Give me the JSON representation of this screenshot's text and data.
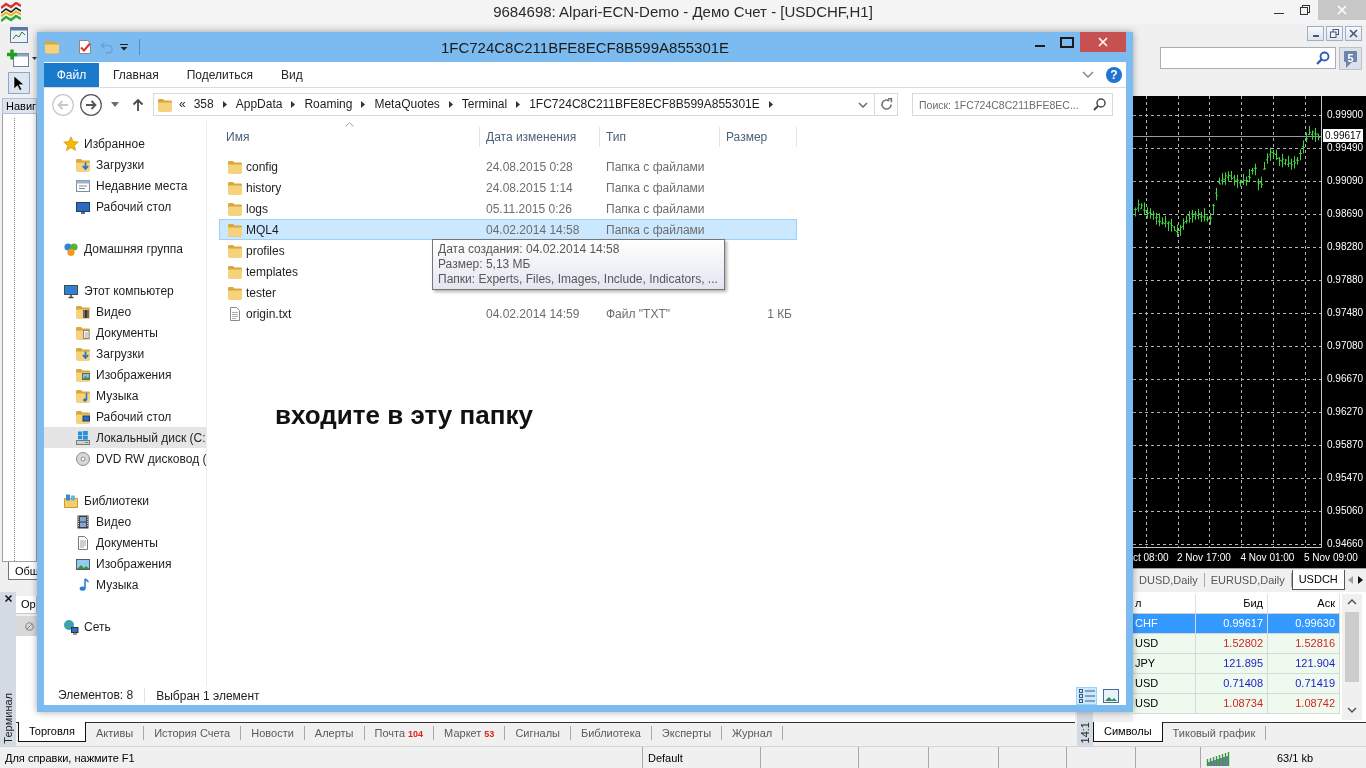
{
  "app": {
    "title": "9684698: Alpari-ECN-Demo - Демо Счет - [USDCHF,H1]"
  },
  "toolbar": {
    "messages": "5"
  },
  "navigator": {
    "title": "Навиг",
    "tabs": [
      {
        "label": "Общ",
        "selected": true
      }
    ]
  },
  "chart": {
    "price_labels": [
      "0.99900",
      "0.99490",
      "0.99090",
      "0.98690",
      "0.98280",
      "0.97880",
      "0.97480",
      "0.97080",
      "0.96670",
      "0.96270",
      "0.95870",
      "0.95470",
      "0.95060",
      "0.94660"
    ],
    "current_price": "0.99617",
    "time_labels": [
      "ct 08:00",
      "2 Nov 17:00",
      "4 Nov 01:00",
      "5 Nov 09:00"
    ]
  },
  "chart_tabs": [
    {
      "label": "DUSD,Daily",
      "selected": false
    },
    {
      "label": "EURUSD,Daily",
      "selected": false
    },
    {
      "label": "USDCH",
      "selected": true
    }
  ],
  "terminal": {
    "title": "Терминал",
    "columns": [
      "Ор"
    ],
    "tabs": [
      {
        "label": "Торговля",
        "selected": true
      },
      {
        "label": "Активы",
        "selected": false
      },
      {
        "label": "История Счета",
        "selected": false
      },
      {
        "label": "Новости",
        "selected": false
      },
      {
        "label": "Алерты",
        "selected": false
      },
      {
        "label": "Почта",
        "count": "104",
        "selected": false
      },
      {
        "label": "Маркет",
        "count": "53",
        "selected": false
      },
      {
        "label": "Сигналы",
        "selected": false
      },
      {
        "label": "Библиотека",
        "selected": false
      },
      {
        "label": "Эксперты",
        "selected": false
      },
      {
        "label": "Журнал",
        "selected": false
      }
    ]
  },
  "market_watch": {
    "title": "14:1",
    "columns": [
      "л",
      "Бид",
      "Аск"
    ],
    "rows": [
      {
        "symbol": "CHF",
        "bid": "0.99617",
        "ask": "0.99630",
        "selected": true
      },
      {
        "symbol": "USD",
        "bid": "1.52802",
        "ask": "1.52816",
        "color": "#d42424",
        "selected": false
      },
      {
        "symbol": "JPY",
        "bid": "121.895",
        "ask": "121.904",
        "color": "#1c1cc8",
        "selected": false
      },
      {
        "symbol": "USD",
        "bid": "0.71408",
        "ask": "0.71419",
        "color": "#1c1cc8",
        "selected": false
      },
      {
        "symbol": "USD",
        "bid": "1.08734",
        "ask": "1.08742",
        "color": "#d42424",
        "selected": false
      }
    ],
    "tabs": [
      {
        "label": "Символы",
        "selected": true
      },
      {
        "label": "Тиковый график",
        "selected": false
      }
    ]
  },
  "status_bar": {
    "help": "Для справки, нажмите F1",
    "profile": "Default",
    "traffic": "63/1 kb"
  },
  "explorer": {
    "title": "1FC724C8C211BFE8ECF8B599A855301E",
    "quick_access": [
      {
        "kind": "folder",
        "disabled": false
      },
      {
        "kind": "properties",
        "disabled": false
      },
      {
        "kind": "undo",
        "disabled": true
      }
    ],
    "ribbon_tabs": [
      {
        "label": "Файл",
        "kind": "file"
      },
      {
        "label": "Главная",
        "kind": "tab"
      },
      {
        "label": "Поделиться",
        "kind": "tab"
      },
      {
        "label": "Вид",
        "kind": "tab"
      }
    ],
    "help": "?",
    "nav_buttons": [
      {
        "kind": "back",
        "disabled": true
      },
      {
        "kind": "forward",
        "disabled": false
      }
    ],
    "address": {
      "overflow": "«",
      "crumbs": [
        "358",
        "AppData",
        "Roaming",
        "MetaQuotes",
        "Terminal",
        "1FC724C8C211BFE8ECF8B599A855301E"
      ]
    },
    "search": {
      "placeholder": "Поиск: 1FC724C8C211BFE8EC..."
    },
    "nav": [
      {
        "label": "Избранное",
        "kind": "star",
        "selected": false,
        "children": [
          {
            "label": "Загрузки",
            "kind": "downloads",
            "selected": false
          },
          {
            "label": "Недавние места",
            "kind": "recent",
            "selected": false
          },
          {
            "label": "Рабочий стол",
            "kind": "desktop",
            "selected": false
          }
        ]
      },
      {
        "label": "Домашняя группа",
        "kind": "homegroup",
        "selected": false
      },
      {
        "label": "Этот компьютер",
        "kind": "computer",
        "selected": false,
        "children": [
          {
            "label": "Видео",
            "kind": "videos",
            "selected": false
          },
          {
            "label": "Документы",
            "kind": "documents",
            "selected": false
          },
          {
            "label": "Загрузки",
            "kind": "downloads",
            "selected": false
          },
          {
            "label": "Изображения",
            "kind": "pictures",
            "selected": false
          },
          {
            "label": "Музыка",
            "kind": "music",
            "selected": false
          },
          {
            "label": "Рабочий стол",
            "kind": "deskfolder",
            "selected": false
          },
          {
            "label": "Локальный диск (C:",
            "kind": "drive",
            "selected": true
          },
          {
            "label": "DVD RW дисковод (",
            "kind": "disc",
            "selected": false
          }
        ]
      },
      {
        "label": "Библиотеки",
        "kind": "libraries",
        "selected": false,
        "children": [
          {
            "label": "Видео",
            "kind": "film",
            "selected": false
          },
          {
            "label": "Документы",
            "kind": "page",
            "selected": false
          },
          {
            "label": "Изображения",
            "kind": "picture",
            "selected": false
          },
          {
            "label": "Музыка",
            "kind": "note",
            "selected": false
          }
        ]
      },
      {
        "label": "Сеть",
        "kind": "network",
        "selected": false
      }
    ],
    "columns": [
      "Имя",
      "Дата изменения",
      "Тип",
      "Размер"
    ],
    "rows": [
      {
        "kind": "folder",
        "name": "config",
        "modified": "24.08.2015 0:28",
        "type": "Папка с файлами",
        "selected": false
      },
      {
        "kind": "folder",
        "name": "history",
        "modified": "24.08.2015 1:14",
        "type": "Папка с файлами",
        "selected": false
      },
      {
        "kind": "folder",
        "name": "logs",
        "modified": "05.11.2015 0:26",
        "type": "Папка с файлами",
        "selected": false
      },
      {
        "kind": "folder",
        "name": "MQL4",
        "modified": "04.02.2014 14:58",
        "type": "Папка с файлами",
        "selected": true
      },
      {
        "kind": "folder",
        "name": "profiles",
        "selected": false
      },
      {
        "kind": "folder",
        "name": "templates",
        "selected": false
      },
      {
        "kind": "folder",
        "name": "tester",
        "selected": false
      },
      {
        "kind": "file",
        "name": "origin.txt",
        "modified": "04.02.2014 14:59",
        "type": "Файл \"TXT\"",
        "size": "1 КБ",
        "selected": false
      }
    ],
    "tooltip": [
      "Дата создания: 04.02.2014 14:58",
      "Размер: 5,13 МБ",
      "Папки: Experts, Files, Images, Include, Indicators, ..."
    ],
    "annotation": "входите в эту папку",
    "status": {
      "items": "Элементов: 8",
      "selection": "Выбран 1 элемент"
    },
    "views": [
      {
        "kind": "details",
        "selected": true
      },
      {
        "kind": "thumbnails",
        "selected": false
      }
    ]
  }
}
